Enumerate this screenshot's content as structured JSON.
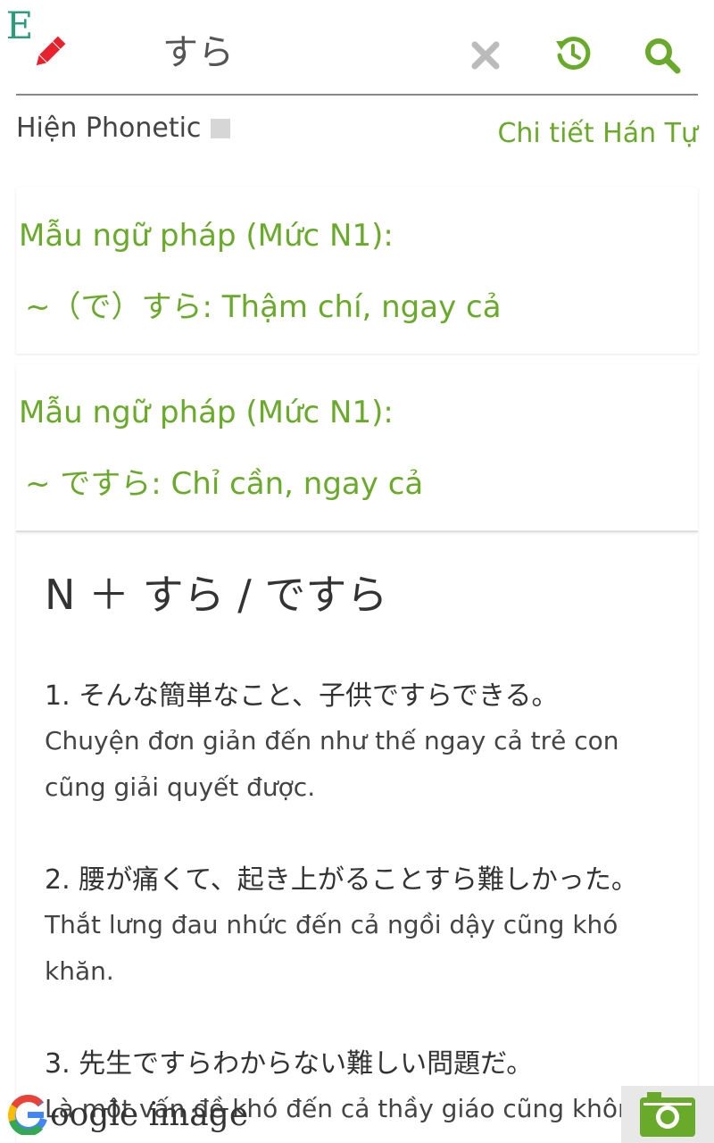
{
  "header": {
    "lang_letter": "E",
    "query": "すら",
    "icons": {
      "edit": "pencil-icon",
      "clear": "close-icon",
      "history": "history-icon",
      "search": "search-icon"
    },
    "colors": {
      "pencil": "#e8212d",
      "accent": "#6aaa2a",
      "clear": "#bbbbbb",
      "lang": "#2a9d7c"
    }
  },
  "options": {
    "phonetic_label": "Hiện Phonetic",
    "phonetic_checked": false,
    "kanji_link": "Chi tiết Hán Tự"
  },
  "grammar_cards": [
    {
      "title": "Mẫu ngữ pháp (Mức N1):",
      "item": "~（で）すら: Thậm chí, ngay cả"
    },
    {
      "title": "Mẫu ngữ pháp (Mức N1):",
      "item": "~ ですら: Chỉ cần, ngay cả"
    }
  ],
  "detail": {
    "pattern": "N ＋ すら / ですら",
    "examples": [
      {
        "jp": "1. そんな簡単なこと、子供ですらできる。",
        "vi": "Chuyện đơn giản đến như thế ngay cả trẻ con cũng giải quyết được."
      },
      {
        "jp": "2. 腰が痛くて、起き上がることすら難しかった。",
        "vi": "Thắt lưng đau nhức đến cả ngồi dậy cũng khó khăn."
      },
      {
        "jp": "3. 先生ですらわからない難しい問題だ。",
        "vi": "Là một vấn đề khó đến cả thầy giáo cũng không hiểu"
      }
    ]
  },
  "overlay": {
    "google_label": "oogle image",
    "google_icon": "google-g-icon",
    "camera_icon": "camera-icon"
  }
}
